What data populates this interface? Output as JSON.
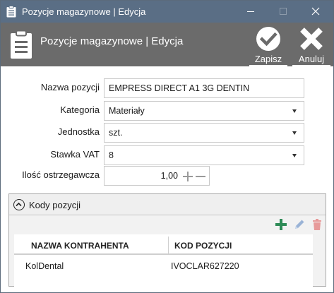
{
  "window": {
    "title": "Pozycje magazynowe | Edycja"
  },
  "header": {
    "title": "Pozycje magazynowe | Edycja",
    "save_label": "Zapisz",
    "cancel_label": "Anuluj"
  },
  "form": {
    "name_label": "Nazwa pozycji",
    "name_value": "EMPRESS DIRECT A1 3G DENTIN",
    "category_label": "Kategoria",
    "category_value": "Materiały",
    "unit_label": "Jednostka",
    "unit_value": "szt.",
    "vat_label": "Stawka VAT",
    "vat_value": "8",
    "warning_qty_label": "Ilość ostrzegawcza",
    "warning_qty_value": "1,00"
  },
  "codes": {
    "title": "Kody pozycji",
    "columns": [
      "NAZWA KONTRAHENTA",
      "KOD POZYCJI"
    ],
    "rows": [
      {
        "contractor": "KolDental",
        "code": "IVOCLAR627220"
      }
    ]
  },
  "colors": {
    "titlebar": "#5a6e85",
    "header": "#6b6b6b",
    "add_green": "#2e8b57",
    "edit_blue": "#9ab3d6",
    "delete_red": "#e79a9a"
  }
}
